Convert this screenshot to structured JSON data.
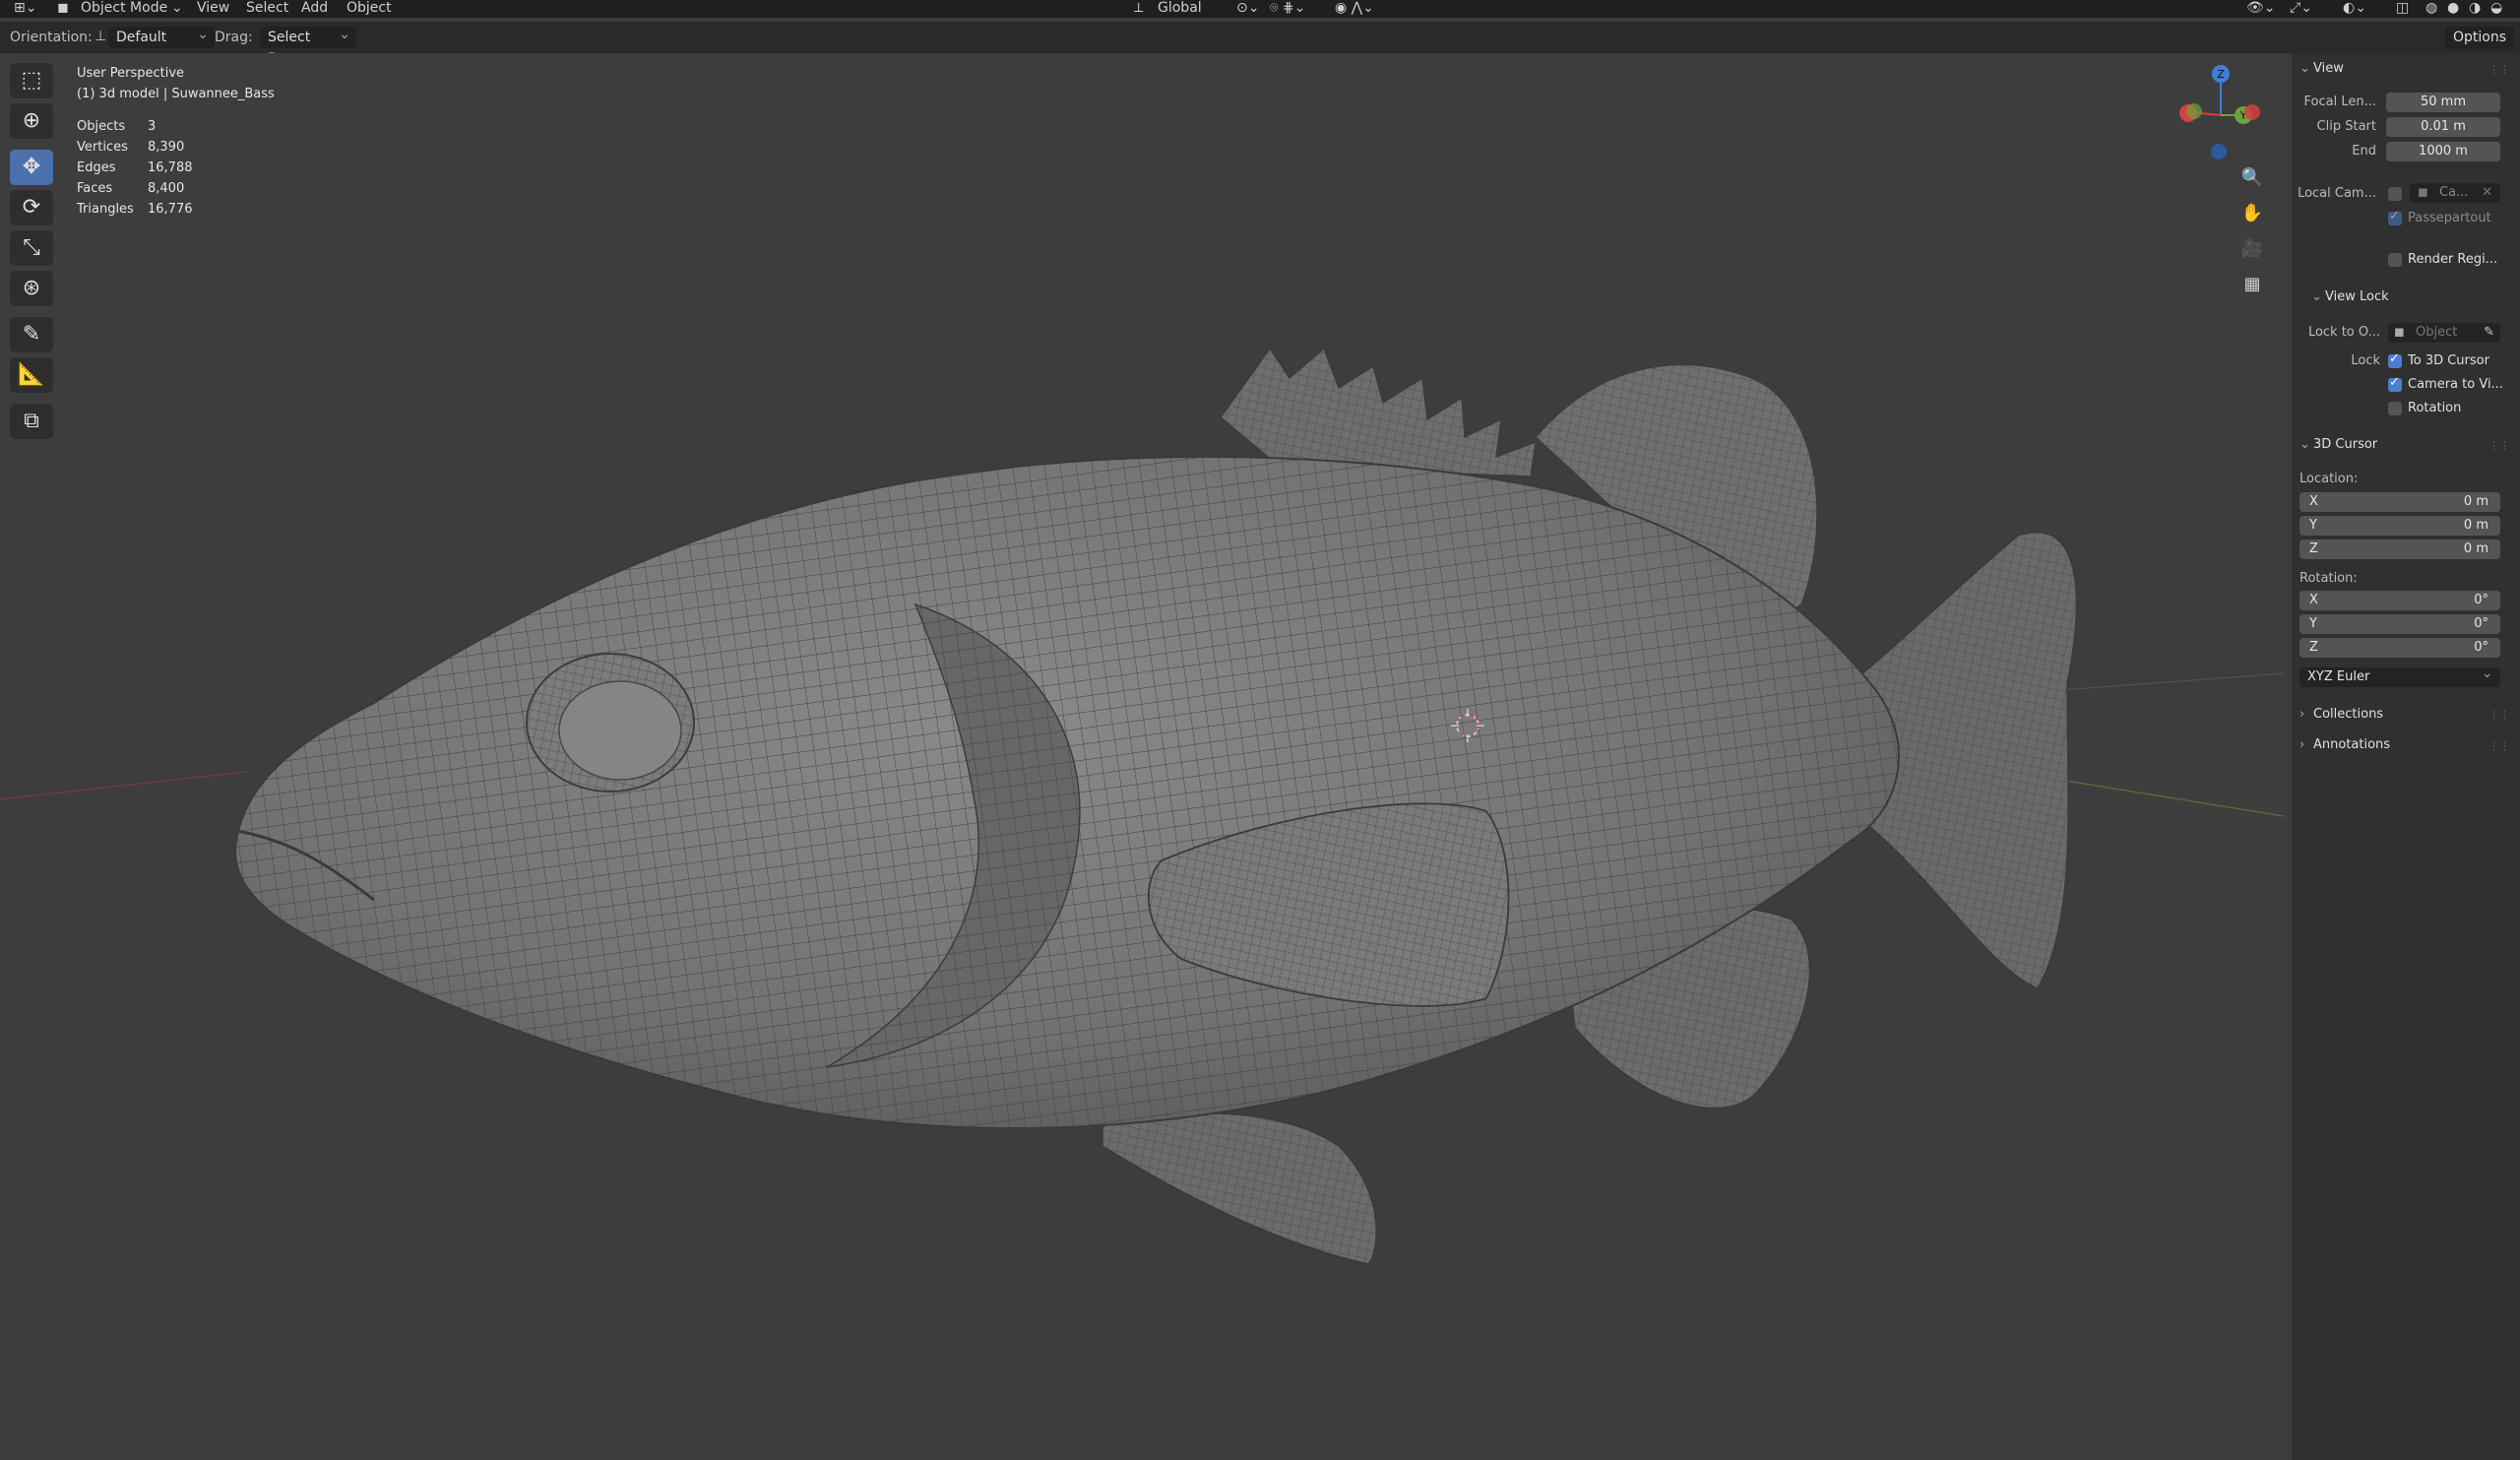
{
  "topbar": {
    "mode": "Object Mode",
    "menus": [
      "View",
      "Select",
      "Add",
      "Object"
    ],
    "transform_orientation": "Global"
  },
  "header": {
    "orientation_label": "Orientation:",
    "orientation_value": "Default",
    "drag_label": "Drag:",
    "drag_value": "Select Box",
    "options": "Options"
  },
  "viewport": {
    "perspective": "User Perspective",
    "object_info": "(1) 3d model | Suwannee_Bass",
    "stats": [
      {
        "label": "Objects",
        "value": "3"
      },
      {
        "label": "Vertices",
        "value": "8,390"
      },
      {
        "label": "Edges",
        "value": "16,788"
      },
      {
        "label": "Faces",
        "value": "8,400"
      },
      {
        "label": "Triangles",
        "value": "16,776"
      }
    ],
    "gizmo_axes": {
      "z": "Z",
      "y": "Y",
      "x": "X"
    }
  },
  "toolbar": {
    "tools": [
      "select-box",
      "cursor",
      "move",
      "rotate",
      "scale",
      "transform",
      "annotate",
      "measure",
      "add-cube"
    ]
  },
  "npanel": {
    "view": {
      "title": "View",
      "focal_label": "Focal Len...",
      "focal_value": "50 mm",
      "clip_start_label": "Clip Start",
      "clip_start_value": "0.01 m",
      "end_label": "End",
      "end_value": "1000 m",
      "local_cam_label": "Local Cam...",
      "local_cam_value": "Ca...",
      "passepartout": "Passepartout",
      "render_region": "Render Regi..."
    },
    "view_lock": {
      "title": "View Lock",
      "lock_to_label": "Lock to O...",
      "lock_to_value": "Object",
      "lock_label": "Lock",
      "to_3d_cursor": "To 3D Cursor",
      "camera_to_view": "Camera to Vi...",
      "rotation": "Rotation"
    },
    "cursor": {
      "title": "3D Cursor",
      "location_label": "Location:",
      "loc_x_label": "X",
      "loc_x": "0 m",
      "loc_y_label": "Y",
      "loc_y": "0 m",
      "loc_z_label": "Z",
      "loc_z": "0 m",
      "rotation_label": "Rotation:",
      "rot_x_label": "X",
      "rot_x": "0°",
      "rot_y_label": "Y",
      "rot_y": "0°",
      "rot_z_label": "Z",
      "rot_z": "0°",
      "rotation_mode": "XYZ Euler"
    },
    "collections": "Collections",
    "annotations": "Annotations"
  },
  "colors": {
    "accent": "#4a7fd0",
    "viewport_bg": "#3d3d3d",
    "axis_x": "#d4413f",
    "axis_y": "#6ea23a",
    "axis_z": "#3c7fd6"
  }
}
